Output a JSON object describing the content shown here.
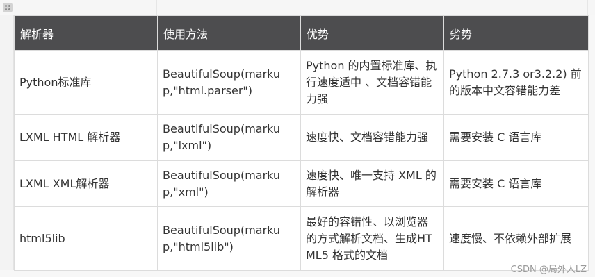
{
  "headers": [
    "解析器",
    "使用方法",
    "优势",
    "劣势"
  ],
  "rows": [
    [
      "Python标准库",
      "BeautifulSoup(markup,\"html.parser\")",
      "Python 的内置标准库、执行速度适中 、文档容错能力强",
      "Python 2.7.3 or3.2.2) 前的版本中文容错能力差"
    ],
    [
      "LXML HTML 解析器",
      "BeautifulSoup(markup,\"lxml\")",
      "速度快、文档容错能力强",
      "需要安装 C 语言库"
    ],
    [
      "LXML XML解析器",
      "BeautifulSoup(markup,\"xml\")",
      "速度快、唯一支持 XML 的解析器",
      "需要安装 C 语言库"
    ],
    [
      "html5lib",
      "BeautifulSoup(markup,\"html5lib\")",
      "最好的容错性、以浏览器的方式解析文档、生成HTML5 格式的文档",
      "速度慢、不依赖外部扩展"
    ]
  ],
  "watermark": "CSDN @局外人LZ"
}
